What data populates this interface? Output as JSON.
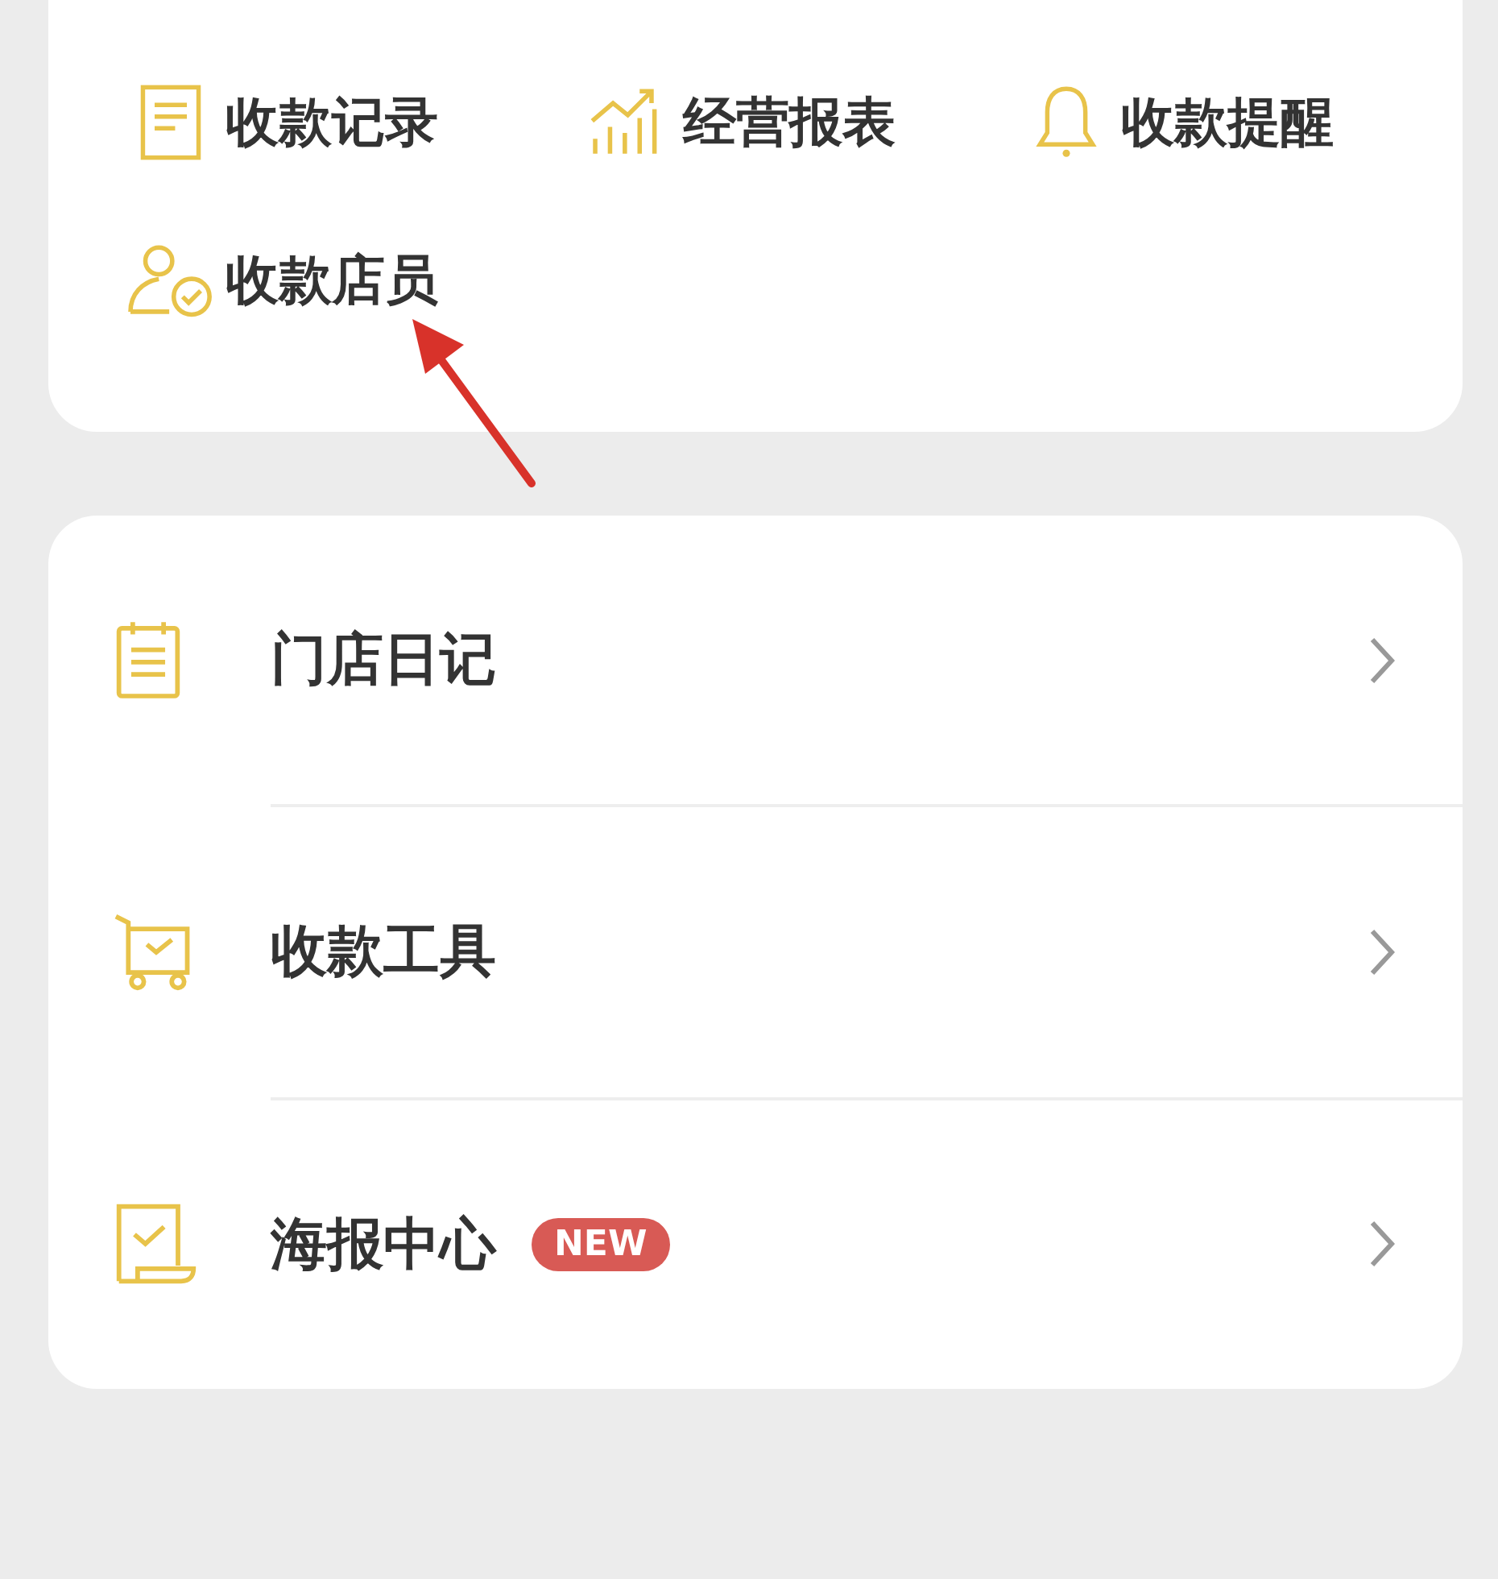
{
  "shortcuts": [
    {
      "label": "收款记录"
    },
    {
      "label": "经营报表"
    },
    {
      "label": "收款提醒"
    },
    {
      "label": "收款店员"
    }
  ],
  "menu": [
    {
      "label": "门店日记"
    },
    {
      "label": "收款工具"
    },
    {
      "label": "海报中心",
      "badge": "NEW"
    }
  ]
}
